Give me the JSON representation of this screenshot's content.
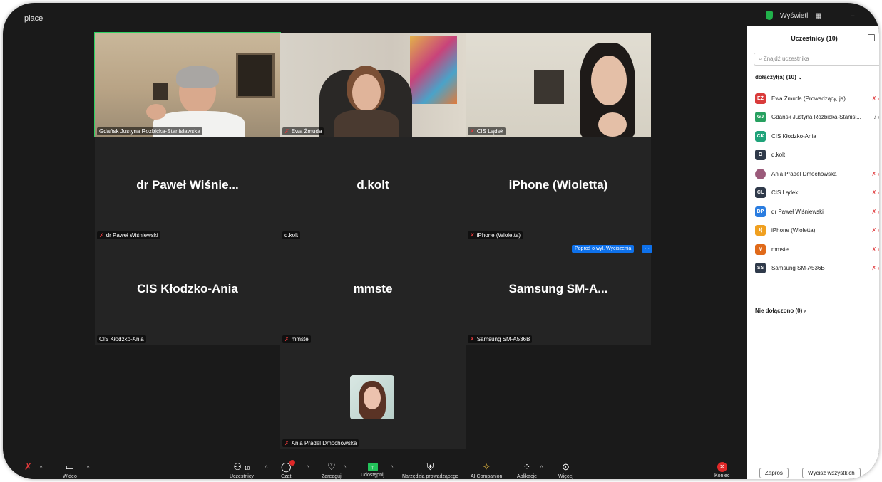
{
  "window": {
    "title": "place",
    "view_label": "Wyświetl",
    "minimize": "–"
  },
  "tiles": [
    {
      "label": "Gdańsk Justyna Rozbicka-Stanisławska",
      "muted": false
    },
    {
      "label": "Ewa Żmuda",
      "muted": true
    },
    {
      "label": "CIS Lądek",
      "muted": true
    },
    {
      "big_name": "dr Paweł Wiśnie...",
      "label": "dr Paweł Wiśniewski",
      "muted": true
    },
    {
      "big_name": "d.kolt",
      "label": "d.kolt",
      "muted": false
    },
    {
      "big_name": "iPhone (Wioletta)",
      "label": "iPhone (Wioletta)",
      "muted": true
    },
    {
      "big_name": "CIS Kłodzko-Ania",
      "label": "CIS Kłodzko-Ania",
      "muted": false
    },
    {
      "big_name": "mmste",
      "label": "mmste",
      "muted": true
    },
    {
      "big_name": "Samsung SM-A...",
      "label": "Samsung SM-A536B",
      "muted": true
    },
    {
      "label": "Ania Pradel Dmochowska",
      "muted": true
    }
  ],
  "tile_actions": {
    "ask_unmute": "Poproś o wył. Wyciszenia",
    "more": "···"
  },
  "panel": {
    "title": "Uczestnicy (10)",
    "search_placeholder": "Znajdź uczestnika",
    "joined_header": "dołączył(a) (10)",
    "participants": [
      {
        "initials": "EŻ",
        "color": "#d93b3b",
        "name": "Ewa Żmuda (Prowadzący, ja)",
        "status": "muted"
      },
      {
        "initials": "GJ",
        "color": "#27a060",
        "name": "Gdańsk Justyna Rozbicka-Stanisł...",
        "status": "mic-on"
      },
      {
        "initials": "CK",
        "color": "#1fa37a",
        "name": "CIS Kłodzko-Ania",
        "status": "none"
      },
      {
        "initials": "D",
        "color": "#2f3a4a",
        "name": "d.kolt",
        "status": "none"
      },
      {
        "initials": "",
        "color": "#9b5a7a",
        "name": "Ania Pradel Dmochowska",
        "status": "muted"
      },
      {
        "initials": "CL",
        "color": "#2f3a4a",
        "name": "CIS Lądek",
        "status": "muted"
      },
      {
        "initials": "DP",
        "color": "#2b7de0",
        "name": "dr Paweł Wiśniewski",
        "status": "muted"
      },
      {
        "initials": "I(",
        "color": "#f0a020",
        "name": "iPhone (Wioletta)",
        "status": "muted"
      },
      {
        "initials": "M",
        "color": "#e06a1a",
        "name": "mmste",
        "status": "muted"
      },
      {
        "initials": "SS",
        "color": "#2f3a4a",
        "name": "Samsung SM-A536B",
        "status": "muted"
      }
    ],
    "not_joined": "Nie dołączono (0)",
    "invite": "Zaproś",
    "mute_all": "Wycisz wszystkich"
  },
  "toolbar": {
    "video": "Wideo",
    "participants": "Uczestnicy",
    "participants_count": "10",
    "chat": "Czat",
    "chat_badge": "1",
    "react": "Zareaguj",
    "share": "Udostępnij",
    "host_tools": "Narzędzia prowadzącego",
    "ai": "AI Companion",
    "apps": "Aplikacje",
    "more": "Więcej",
    "end": "Koniec"
  }
}
